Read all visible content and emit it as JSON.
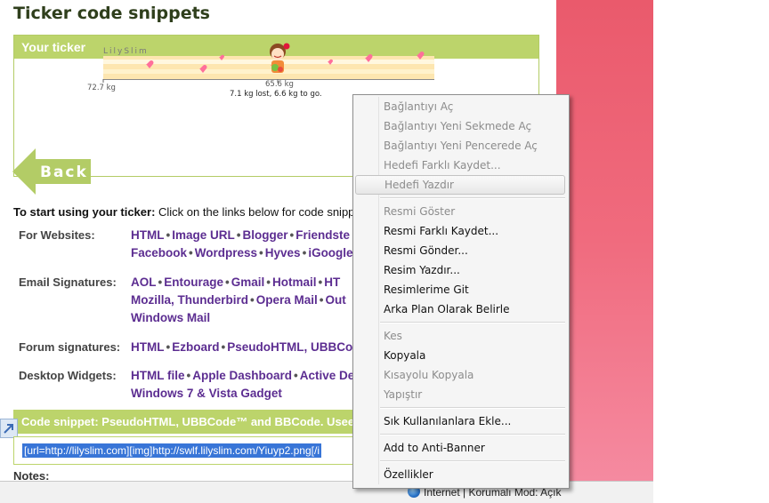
{
  "page": {
    "title": "Ticker code snippets",
    "ticker_header": "Your ticker",
    "ticker_brand": "LilySlim",
    "ticker_start": "72.7 kg",
    "ticker_current": "65.6 kg",
    "ticker_status": "7.1 kg lost, 6.6 kg to go.",
    "ticker_progress_fraction": 0.52,
    "back_label": "Back",
    "intro_bold": "To start using your ticker:",
    "intro_text": " Click on the links below for code snipp",
    "rows": [
      {
        "label": "For Websites:",
        "lines": [
          [
            "HTML",
            "Image URL",
            "Blogger",
            "Friendste"
          ],
          [
            "Facebook",
            "Wordpress",
            "Hyves",
            "iGoogle"
          ]
        ]
      },
      {
        "label": "Email Signatures:",
        "lines": [
          [
            "AOL",
            "Entourage",
            "Gmail",
            "Hotmail",
            "HT"
          ],
          [
            "Mozilla, Thunderbird",
            "Opera Mail",
            "Out"
          ],
          [
            "Windows Mail"
          ]
        ]
      },
      {
        "label": "Forum signatures:",
        "lines": [
          [
            "HTML",
            "Ezboard",
            "PseudoHTML, UBBCo"
          ]
        ]
      },
      {
        "label": "Desktop Widgets:",
        "lines": [
          [
            "HTML file",
            "Apple Dashboard",
            "Active De"
          ],
          [
            "Windows 7 & Vista Gadget"
          ]
        ]
      }
    ],
    "snippet_header": "Code snippet: PseudoHTML, UBBCode™ and BBCode. Usee",
    "snippet_code": "[url=http://lilyslim.com][img]http://swlf.lilyslim.com/Yiuyp2.png[/i",
    "notes_label": "Notes:"
  },
  "status_bar": {
    "zone_text": "Internet | Korumalı Mod: Açık"
  },
  "context_menu": {
    "groups": [
      [
        {
          "label": "Bağlantıyı Aç",
          "enabled": false
        },
        {
          "label": "Bağlantıyı Yeni Sekmede Aç",
          "enabled": false
        },
        {
          "label": "Bağlantıyı Yeni Pencerede Aç",
          "enabled": false
        },
        {
          "label": "Hedefi Farklı Kaydet...",
          "enabled": false
        },
        {
          "label": "Hedefi Yazdır",
          "enabled": false,
          "hover": true
        }
      ],
      [
        {
          "label": "Resmi Göster",
          "enabled": false
        },
        {
          "label": "Resmi Farklı Kaydet...",
          "enabled": true
        },
        {
          "label": "Resmi Gönder...",
          "enabled": true
        },
        {
          "label": "Resim Yazdır...",
          "enabled": true
        },
        {
          "label": "Resimlerime Git",
          "enabled": true
        },
        {
          "label": "Arka Plan Olarak Belirle",
          "enabled": true
        }
      ],
      [
        {
          "label": "Kes",
          "enabled": false
        },
        {
          "label": "Kopyala",
          "enabled": true
        },
        {
          "label": "Kısayolu Kopyala",
          "enabled": false
        },
        {
          "label": "Yapıştır",
          "enabled": false
        }
      ],
      [
        {
          "label": "Sık Kullanılanlara Ekle...",
          "enabled": true
        }
      ],
      [
        {
          "label": "Add to Anti-Banner",
          "enabled": true
        }
      ],
      [
        {
          "label": "Özellikler",
          "enabled": true
        }
      ]
    ]
  },
  "colors": {
    "header_green": "#bcd46b",
    "link_purple": "#5c2d91",
    "selection_blue": "#3875d7",
    "side_pink": "#ea5a6c"
  }
}
